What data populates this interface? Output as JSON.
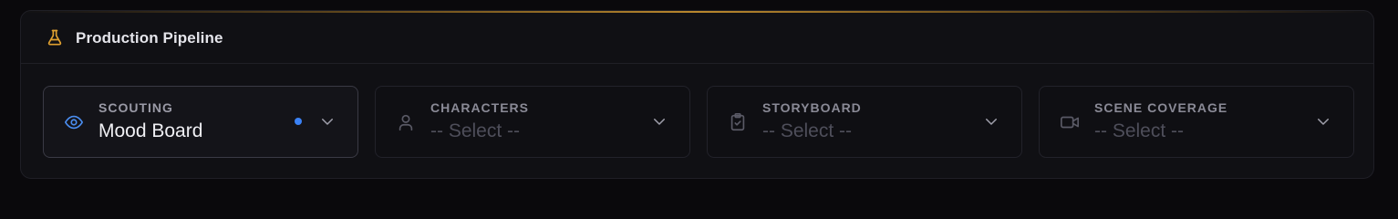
{
  "panel": {
    "title": "Production Pipeline",
    "title_icon": "flask-icon",
    "accent_color": "#d69c32"
  },
  "stages": [
    {
      "label": "SCOUTING",
      "value": "Mood Board",
      "icon": "eye-icon",
      "selected": true,
      "status_dot_color": "#3b82f6"
    },
    {
      "label": "CHARACTERS",
      "value": "-- Select --",
      "icon": "user-icon",
      "selected": false
    },
    {
      "label": "STORYBOARD",
      "value": "-- Select --",
      "icon": "clipboard-check-icon",
      "selected": false
    },
    {
      "label": "SCENE COVERAGE",
      "value": "-- Select --",
      "icon": "video-camera-icon",
      "selected": false
    }
  ]
}
